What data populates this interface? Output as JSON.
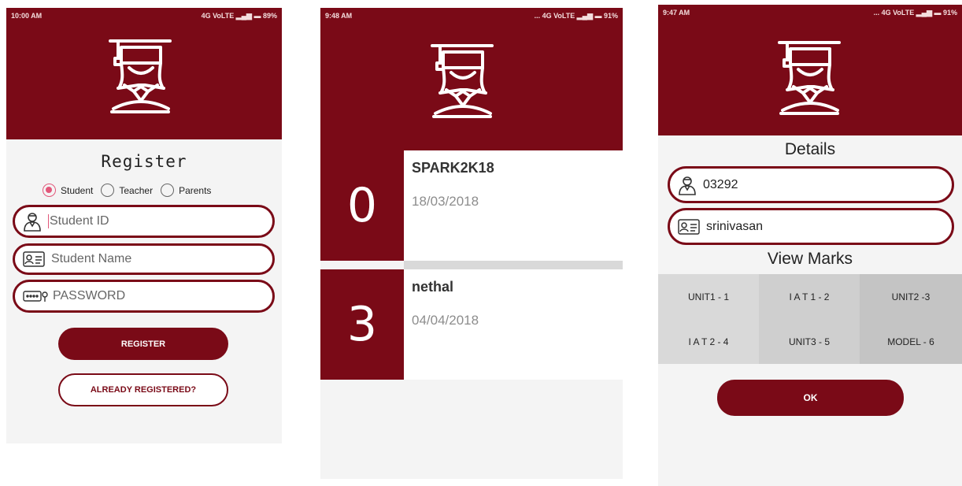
{
  "screens": [
    {
      "status": {
        "time": "10:00 AM",
        "indicators": "4G VoLTE ▂▄▆ ▬ 89%"
      },
      "title": "Register",
      "roles": [
        {
          "label": "Student",
          "checked": true
        },
        {
          "label": "Teacher",
          "checked": false
        },
        {
          "label": "Parents",
          "checked": false
        }
      ],
      "student_id": {
        "placeholder": "Student ID",
        "icon": "user-icon"
      },
      "student_name": {
        "placeholder": "Student Name",
        "icon": "id-card-icon"
      },
      "password": {
        "placeholder": "PASSWORD",
        "icon": "password-icon"
      },
      "register_label": "REGISTER",
      "already_label": "ALREADY REGISTERED?"
    },
    {
      "status": {
        "time": "9:48 AM",
        "indicators": "... 4G VoLTE ▂▄▆ ▬ 91%"
      },
      "events": [
        {
          "number": "0",
          "name": "SPARK2K18",
          "date": "18/03/2018"
        },
        {
          "number": "3",
          "name": "nethal",
          "date": "04/04/2018"
        }
      ]
    },
    {
      "status": {
        "time": "9:47 AM",
        "indicators": "... 4G VoLTE ▂▄▆ ▬ 91%"
      },
      "details_title": "Details",
      "id_value": "03292",
      "name_value": "srinivasan",
      "marks_title": "View Marks",
      "marks": [
        "UNIT1 - 1",
        "I A T 1 - 2",
        "UNIT2 -3",
        "I A T 2 - 4",
        "UNIT3 - 5",
        "MODEL - 6"
      ],
      "ok_label": "OK"
    }
  ],
  "colors": {
    "primary": "#7a0a17",
    "accent": "#e2577a",
    "background": "#f4f4f4"
  }
}
